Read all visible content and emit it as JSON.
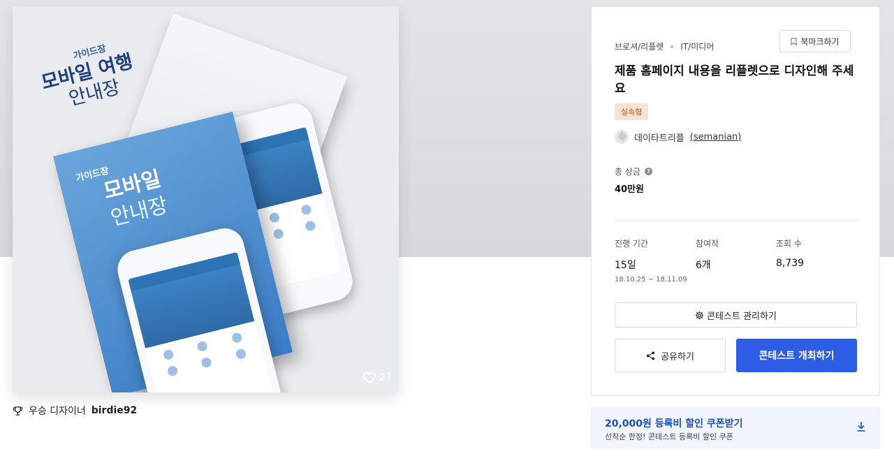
{
  "hero": {
    "back_leaflet": {
      "small": "가이드장",
      "title_line1": "모바일 여행",
      "title_line2": "안내장"
    },
    "front_leaflet": {
      "small": "가이드장",
      "title_line1": "모바일",
      "title_line2": "안내장"
    },
    "like_count": "27"
  },
  "winner": {
    "label": "우승 디자이너",
    "name": "birdie92"
  },
  "contest": {
    "categories": [
      "브로셔/리플렛",
      "IT/미디어"
    ],
    "bookmark_label": "북마크하기",
    "title": "제품 홈페이지 내용을 리플렛으로 디자인해 주세요",
    "badge": "실속형",
    "host_name": "데이타트리플",
    "host_id": "(semanian)",
    "prize_label": "총 상금",
    "prize_help": "?",
    "prize_value": "40만원",
    "stats": [
      {
        "label": "진행 기간",
        "value": "15일",
        "sub": "18.10.25 ~ 18.11.09"
      },
      {
        "label": "참여작",
        "value": "6개",
        "sub": ""
      },
      {
        "label": "조회 수",
        "value": "8,739",
        "sub": ""
      }
    ],
    "manage_label": "콘테스트 관리하기",
    "share_label": "공유하기",
    "host_button_label": "콘테스트 개최하기"
  },
  "coupon": {
    "title": "20,000원 등록비 할인 쿠폰받기",
    "subtitle": "선착순 한정! 콘테스트 등록비 할인 쿠폰"
  },
  "colors": {
    "primary": "#2d5de5",
    "badge_bg": "#f8e2d2",
    "badge_text": "#b4582a",
    "coupon_bg": "#f1f5fd",
    "coupon_text": "#1e4fc4"
  },
  "icons": [
    "heart-icon",
    "trophy-icon",
    "bookmark-icon",
    "help-icon",
    "gear-icon",
    "share-icon",
    "download-icon"
  ]
}
